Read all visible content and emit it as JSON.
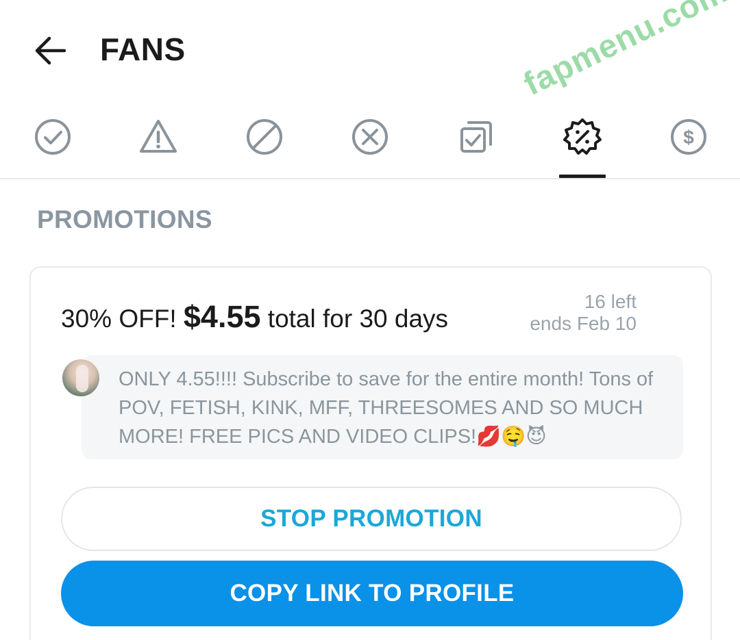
{
  "header": {
    "title": "FANS",
    "back_icon": "arrow-left-icon"
  },
  "watermark": "fapmenu.com",
  "tabs": [
    {
      "icon": "check-circle-icon",
      "active": false
    },
    {
      "icon": "warning-triangle-icon",
      "active": false
    },
    {
      "icon": "blocked-icon",
      "active": false
    },
    {
      "icon": "x-circle-icon",
      "active": false
    },
    {
      "icon": "checked-copies-icon",
      "active": false
    },
    {
      "icon": "promotion-badge-icon",
      "active": true
    },
    {
      "icon": "dollar-circle-icon",
      "active": false
    }
  ],
  "section": {
    "label": "PROMOTIONS"
  },
  "promotion": {
    "discount_text": "30% OFF! ",
    "price": "$4.55",
    "duration_text": " total for 30 days",
    "remaining": "16 left",
    "ends": "ends Feb 10",
    "message": "ONLY 4.55!!!! Subscribe to save for the entire month! Tons of POV, FETISH, KINK, MFF, THREESOMES AND SO MUCH MORE! FREE PICS AND VIDEO CLIPS!💋🤤😈",
    "stop_label": "STOP PROMOTION",
    "copy_label": "COPY LINK TO PROFILE"
  },
  "colors": {
    "accent": "#0a91e8",
    "link_text": "#1ca7d8",
    "icon_gray": "#8a939a",
    "muted_text": "#8a959d"
  }
}
